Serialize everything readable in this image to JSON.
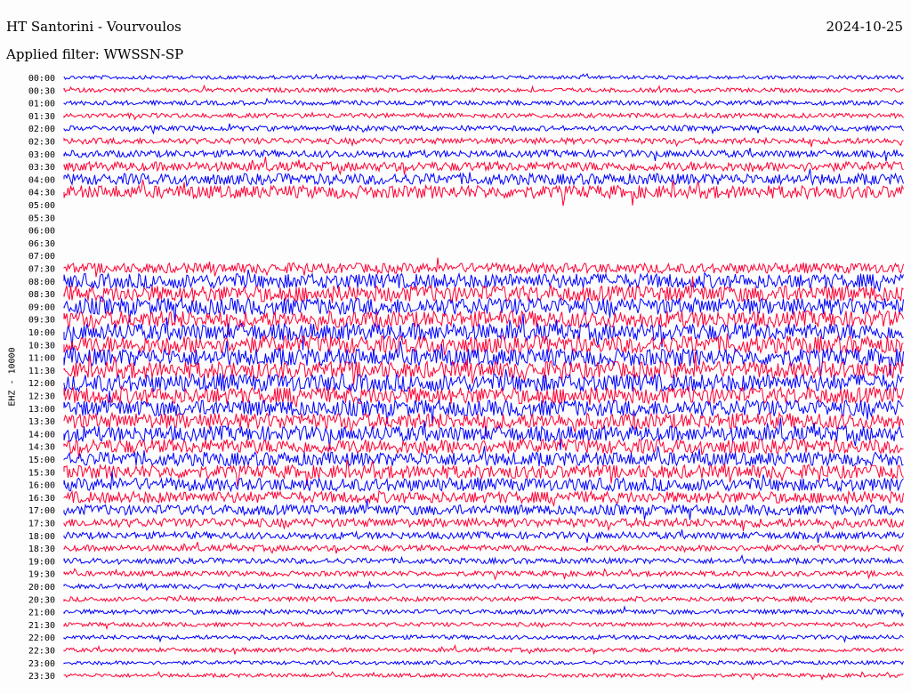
{
  "header": {
    "station": "HT Santorini - Vourvoulos",
    "date": "2024-10-25",
    "filter": "Applied filter: WWSSN-SP"
  },
  "chart_data": {
    "type": "line",
    "title": "HT Santorini - Vourvoulos",
    "ylabel": "EHZ - 10000",
    "trace_colors": [
      "#0000ff",
      "#ff0033"
    ],
    "rows": [
      {
        "label": "00:00",
        "level": 0.8
      },
      {
        "label": "00:30",
        "level": 0.9
      },
      {
        "label": "01:00",
        "level": 1.0
      },
      {
        "label": "01:30",
        "level": 1.0
      },
      {
        "label": "02:00",
        "level": 1.1
      },
      {
        "label": "02:30",
        "level": 1.3
      },
      {
        "label": "03:00",
        "level": 1.5
      },
      {
        "label": "03:30",
        "level": 2.0
      },
      {
        "label": "04:00",
        "level": 2.4
      },
      {
        "label": "04:30",
        "level": 2.8
      },
      {
        "label": "05:00",
        "level": 0.0
      },
      {
        "label": "05:30",
        "level": 0.0
      },
      {
        "label": "06:00",
        "level": 0.0
      },
      {
        "label": "06:30",
        "level": 0.0
      },
      {
        "label": "07:00",
        "level": 0.0
      },
      {
        "label": "07:30",
        "level": 2.2
      },
      {
        "label": "08:00",
        "level": 3.2
      },
      {
        "label": "08:30",
        "level": 3.5
      },
      {
        "label": "09:00",
        "level": 3.6
      },
      {
        "label": "09:30",
        "level": 3.6
      },
      {
        "label": "10:00",
        "level": 3.7
      },
      {
        "label": "10:30",
        "level": 3.8
      },
      {
        "label": "11:00",
        "level": 3.8
      },
      {
        "label": "11:30",
        "level": 3.7
      },
      {
        "label": "12:00",
        "level": 3.8
      },
      {
        "label": "12:30",
        "level": 3.6
      },
      {
        "label": "13:00",
        "level": 3.5
      },
      {
        "label": "13:30",
        "level": 3.4
      },
      {
        "label": "14:00",
        "level": 3.3
      },
      {
        "label": "14:30",
        "level": 3.1
      },
      {
        "label": "15:00",
        "level": 3.0
      },
      {
        "label": "15:30",
        "level": 2.9
      },
      {
        "label": "16:00",
        "level": 2.8
      },
      {
        "label": "16:30",
        "level": 2.5
      },
      {
        "label": "17:00",
        "level": 2.2
      },
      {
        "label": "17:30",
        "level": 1.9
      },
      {
        "label": "18:00",
        "level": 1.5
      },
      {
        "label": "18:30",
        "level": 1.3
      },
      {
        "label": "19:00",
        "level": 1.2
      },
      {
        "label": "19:30",
        "level": 1.1
      },
      {
        "label": "20:00",
        "level": 1.0
      },
      {
        "label": "20:30",
        "level": 1.0
      },
      {
        "label": "21:00",
        "level": 1.0
      },
      {
        "label": "21:30",
        "level": 0.9
      },
      {
        "label": "22:00",
        "level": 0.9
      },
      {
        "label": "22:30",
        "level": 0.9
      },
      {
        "label": "23:00",
        "level": 0.8
      },
      {
        "label": "23:30",
        "level": 0.8
      }
    ]
  }
}
